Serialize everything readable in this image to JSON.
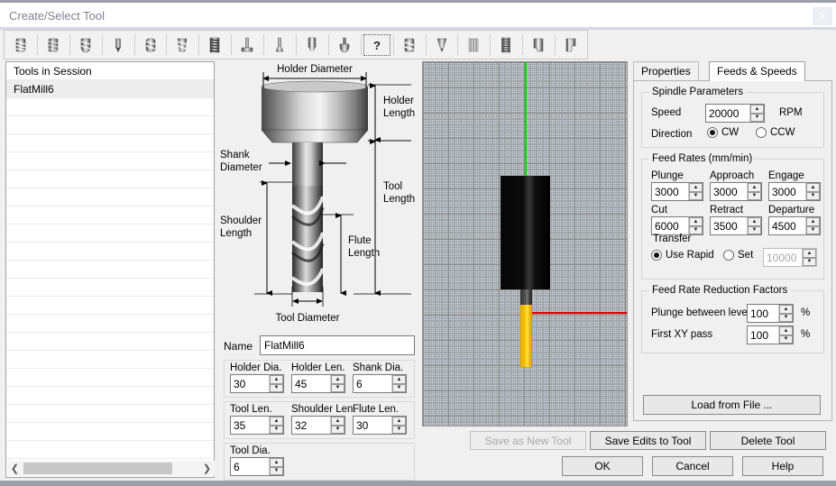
{
  "window": {
    "title": "Create/Select Tool",
    "close_label": "✕"
  },
  "toolbar": {
    "icons": [
      {
        "name": "endmill-flat-icon",
        "selected": false
      },
      {
        "name": "endmill-rough-icon",
        "selected": false
      },
      {
        "name": "endmill-ball-icon",
        "selected": false
      },
      {
        "name": "drill-icon",
        "selected": false
      },
      {
        "name": "endmill-bull-icon",
        "selected": false
      },
      {
        "name": "endmill-taper-icon",
        "selected": false
      },
      {
        "name": "thread-mill-icon",
        "selected": false
      },
      {
        "name": "tslot-cutter-icon",
        "selected": false
      },
      {
        "name": "dovetail-cutter-icon",
        "selected": false
      },
      {
        "name": "chamfer-mill-icon",
        "selected": false
      },
      {
        "name": "lollipop-cutter-icon",
        "selected": false
      },
      {
        "name": "unknown-tool-icon",
        "selected": true
      },
      {
        "name": "endmill-generic-icon",
        "selected": false
      },
      {
        "name": "engraver-icon",
        "selected": false
      },
      {
        "name": "saw-blade-icon",
        "selected": false
      },
      {
        "name": "tap-icon",
        "selected": false
      },
      {
        "name": "corner-round-icon",
        "selected": false
      },
      {
        "name": "face-mill-icon",
        "selected": false
      }
    ]
  },
  "tools_panel": {
    "header": "Tools in Session",
    "items": [
      {
        "label": "FlatMill6",
        "selected": true
      }
    ],
    "empty_rows": 20,
    "scroll_left": "❮",
    "scroll_right": "❯"
  },
  "diagram": {
    "labels": {
      "holder_diameter": "Holder Diameter",
      "holder_length_1": "Holder",
      "holder_length_2": "Length",
      "shank_diameter_1": "Shank",
      "shank_diameter_2": "Diameter",
      "tool_length_1": "Tool",
      "tool_length_2": "Length",
      "shoulder_length_1": "Shoulder",
      "shoulder_length_2": "Length",
      "flute_length_1": "Flute",
      "flute_length_2": "Length",
      "tool_diameter": "Tool Diameter"
    }
  },
  "form": {
    "name_label": "Name",
    "name_value": "FlatMill6",
    "fields": [
      {
        "label": "Holder Dia.",
        "value": "30"
      },
      {
        "label": "Holder Len.",
        "value": "45"
      },
      {
        "label": "Shank Dia.",
        "value": "6"
      },
      {
        "label": "Tool Len.",
        "value": "35"
      },
      {
        "label": "Shoulder Len.",
        "value": "32"
      },
      {
        "label": "Flute Len.",
        "value": "30"
      },
      {
        "label": "Tool Dia.",
        "value": "6"
      }
    ]
  },
  "tabs": [
    {
      "label": "Properties",
      "active": false
    },
    {
      "label": "Feeds & Speeds",
      "active": true
    }
  ],
  "spindle": {
    "caption": "Spindle Parameters",
    "speed_label": "Speed",
    "speed_value": "20000",
    "speed_unit": "RPM",
    "direction_label": "Direction",
    "cw_label": "CW",
    "ccw_label": "CCW",
    "direction_selected": "CW"
  },
  "feed_rates": {
    "caption": "Feed Rates (mm/min)",
    "items": [
      {
        "label": "Plunge",
        "value": "3000"
      },
      {
        "label": "Approach",
        "value": "3000"
      },
      {
        "label": "Engage",
        "value": "3000"
      },
      {
        "label": "Cut",
        "value": "6000"
      },
      {
        "label": "Retract",
        "value": "3500"
      },
      {
        "label": "Departure",
        "value": "4500"
      }
    ],
    "transfer_caption": "Transfer",
    "use_rapid_label": "Use Rapid",
    "set_label": "Set",
    "transfer_selected": "Use Rapid",
    "transfer_value": "10000"
  },
  "reduction": {
    "caption": "Feed Rate Reduction Factors",
    "items": [
      {
        "label": "Plunge between levels",
        "value": "100",
        "unit": "%"
      },
      {
        "label": "First XY pass",
        "value": "100",
        "unit": "%"
      }
    ]
  },
  "buttons": {
    "load_from_file": "Load from File ...",
    "save_as_new_tool": "Save as New Tool",
    "save_edits_to_tool": "Save Edits to Tool",
    "delete_tool": "Delete Tool",
    "ok": "OK",
    "cancel": "Cancel",
    "help": "Help"
  },
  "spinner": {
    "up": "▲",
    "down": "▼"
  }
}
